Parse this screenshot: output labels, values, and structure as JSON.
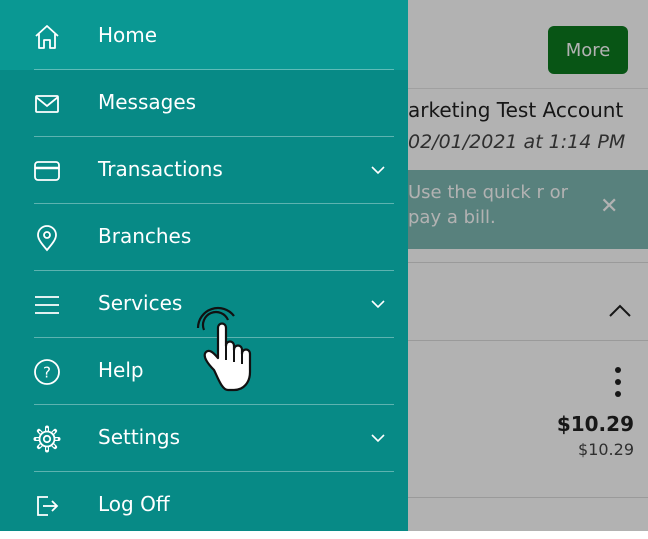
{
  "background": {
    "more_label": "More",
    "account_name": "arketing Test Account",
    "account_date": "02/01/2021 at 1:14 PM",
    "tip_text": "Use the quick r or pay a bill.",
    "amount_primary": "$10.29",
    "amount_secondary": "$10.29"
  },
  "menu": {
    "items": [
      {
        "label": "Home",
        "icon": "home-icon"
      },
      {
        "label": "Messages",
        "icon": "envelope-icon"
      },
      {
        "label": "Transactions",
        "icon": "credit-card-icon"
      },
      {
        "label": "Branches",
        "icon": "location-pin-icon"
      },
      {
        "label": "Services",
        "icon": "hamburger-icon"
      },
      {
        "label": "Help",
        "icon": "question-icon"
      },
      {
        "label": "Settings",
        "icon": "gear-icon"
      },
      {
        "label": "Log Off",
        "icon": "logout-icon"
      }
    ]
  },
  "colors": {
    "drawer": "#078a86",
    "drawer_active": "#0a9893",
    "more_button": "#0c7a1f"
  }
}
